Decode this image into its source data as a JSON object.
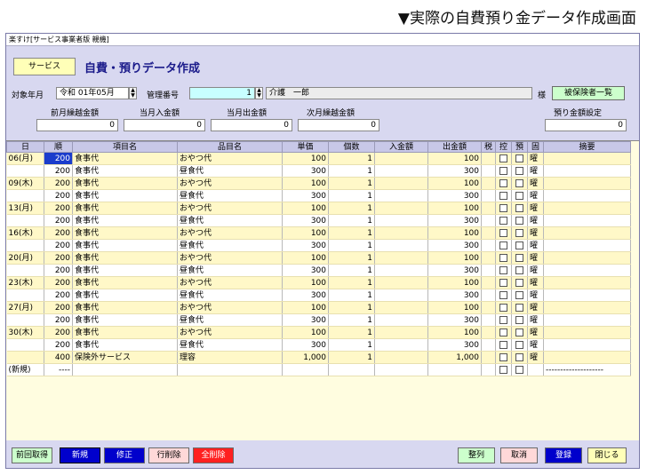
{
  "page_caption": "▼実際の自費預り金データ作成画面",
  "window_title": "楽すけ[サービス事業者版 親機]",
  "header": {
    "service_button": "サービス",
    "screen_title": "自費・預りデータ作成"
  },
  "form": {
    "target_month_label": "対象年月",
    "target_month_value": "令和 01年05月",
    "management_no_label": "管理番号",
    "management_no_value": "1",
    "client_name": "介護　一郎",
    "honorific": "様",
    "insured_list_button": "被保険者一覧",
    "prev_balance_label": "前月繰越金額",
    "prev_balance_value": "0",
    "month_in_label": "当月入金額",
    "month_in_value": "0",
    "month_out_label": "当月出金額",
    "month_out_value": "0",
    "next_balance_label": "次月繰越金額",
    "next_balance_value": "0",
    "deposit_setting_label": "預り金額設定",
    "deposit_setting_value": "0"
  },
  "grid": {
    "headers": [
      "日",
      "順",
      "項目名",
      "品目名",
      "単価",
      "個数",
      "入金額",
      "出金額",
      "税",
      "控",
      "預",
      "固",
      "摘要"
    ],
    "rows": [
      {
        "day": "06(月)",
        "code": "200",
        "item": "食事代",
        "product": "おやつ代",
        "price": "100",
        "qty": "1",
        "in": "",
        "out": "100",
        "fixed": "曜",
        "memo": "",
        "selected": true
      },
      {
        "day": "",
        "code": "200",
        "item": "食事代",
        "product": "昼食代",
        "price": "300",
        "qty": "1",
        "in": "",
        "out": "300",
        "fixed": "曜",
        "memo": ""
      },
      {
        "day": "09(木)",
        "code": "200",
        "item": "食事代",
        "product": "おやつ代",
        "price": "100",
        "qty": "1",
        "in": "",
        "out": "100",
        "fixed": "曜",
        "memo": ""
      },
      {
        "day": "",
        "code": "200",
        "item": "食事代",
        "product": "昼食代",
        "price": "300",
        "qty": "1",
        "in": "",
        "out": "300",
        "fixed": "曜",
        "memo": ""
      },
      {
        "day": "13(月)",
        "code": "200",
        "item": "食事代",
        "product": "おやつ代",
        "price": "100",
        "qty": "1",
        "in": "",
        "out": "100",
        "fixed": "曜",
        "memo": ""
      },
      {
        "day": "",
        "code": "200",
        "item": "食事代",
        "product": "昼食代",
        "price": "300",
        "qty": "1",
        "in": "",
        "out": "300",
        "fixed": "曜",
        "memo": ""
      },
      {
        "day": "16(木)",
        "code": "200",
        "item": "食事代",
        "product": "おやつ代",
        "price": "100",
        "qty": "1",
        "in": "",
        "out": "100",
        "fixed": "曜",
        "memo": ""
      },
      {
        "day": "",
        "code": "200",
        "item": "食事代",
        "product": "昼食代",
        "price": "300",
        "qty": "1",
        "in": "",
        "out": "300",
        "fixed": "曜",
        "memo": ""
      },
      {
        "day": "20(月)",
        "code": "200",
        "item": "食事代",
        "product": "おやつ代",
        "price": "100",
        "qty": "1",
        "in": "",
        "out": "100",
        "fixed": "曜",
        "memo": ""
      },
      {
        "day": "",
        "code": "200",
        "item": "食事代",
        "product": "昼食代",
        "price": "300",
        "qty": "1",
        "in": "",
        "out": "300",
        "fixed": "曜",
        "memo": ""
      },
      {
        "day": "23(木)",
        "code": "200",
        "item": "食事代",
        "product": "おやつ代",
        "price": "100",
        "qty": "1",
        "in": "",
        "out": "100",
        "fixed": "曜",
        "memo": ""
      },
      {
        "day": "",
        "code": "200",
        "item": "食事代",
        "product": "昼食代",
        "price": "300",
        "qty": "1",
        "in": "",
        "out": "300",
        "fixed": "曜",
        "memo": ""
      },
      {
        "day": "27(月)",
        "code": "200",
        "item": "食事代",
        "product": "おやつ代",
        "price": "100",
        "qty": "1",
        "in": "",
        "out": "100",
        "fixed": "曜",
        "memo": ""
      },
      {
        "day": "",
        "code": "200",
        "item": "食事代",
        "product": "昼食代",
        "price": "300",
        "qty": "1",
        "in": "",
        "out": "300",
        "fixed": "曜",
        "memo": ""
      },
      {
        "day": "30(木)",
        "code": "200",
        "item": "食事代",
        "product": "おやつ代",
        "price": "100",
        "qty": "1",
        "in": "",
        "out": "100",
        "fixed": "曜",
        "memo": ""
      },
      {
        "day": "",
        "code": "200",
        "item": "食事代",
        "product": "昼食代",
        "price": "300",
        "qty": "1",
        "in": "",
        "out": "300",
        "fixed": "曜",
        "memo": ""
      },
      {
        "day": "",
        "code": "400",
        "item": "保険外サービス",
        "product": "理容",
        "price": "1,000",
        "qty": "1",
        "in": "",
        "out": "1,000",
        "fixed": "曜",
        "memo": ""
      },
      {
        "day": "(新規)",
        "code": "----",
        "item": "",
        "product": "",
        "price": "",
        "qty": "",
        "in": "",
        "out": "",
        "fixed": "",
        "memo": "--------------------",
        "new_row": true
      }
    ]
  },
  "footer": {
    "prev_fetch": "前回取得",
    "new": "新規",
    "modify": "修正",
    "row_delete": "行削除",
    "delete_all": "全削除",
    "sort": "整列",
    "cancel": "取消",
    "register": "登録",
    "close": "閉じる"
  }
}
